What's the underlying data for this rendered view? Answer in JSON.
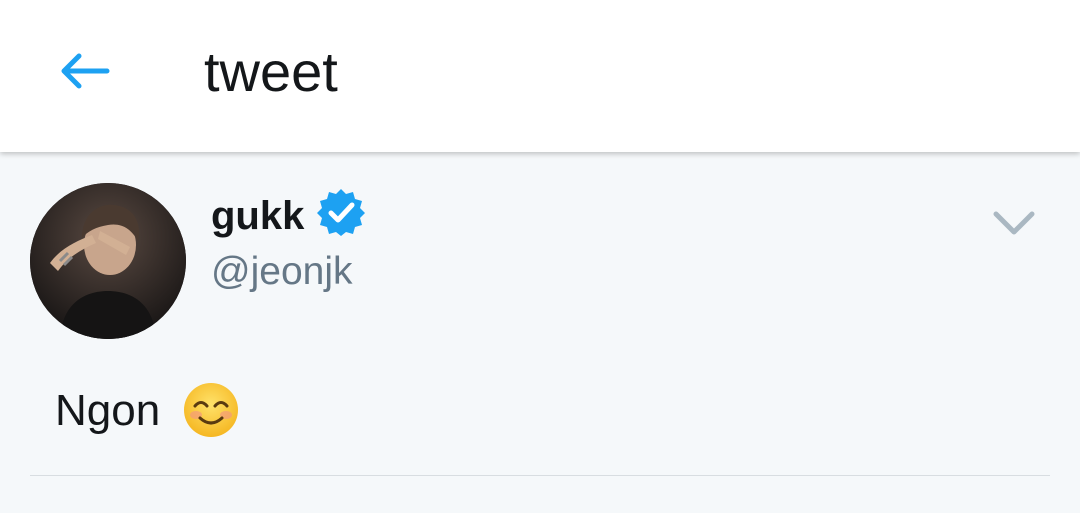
{
  "header": {
    "title": "tweet",
    "back_icon": "arrow-left-icon",
    "accent_color": "#1da1f2"
  },
  "tweet": {
    "display_name": "gukk",
    "verified": true,
    "verified_icon": "verified-badge-icon",
    "handle": "@jeonjk",
    "menu_icon": "chevron-down-icon",
    "text": "Ngon",
    "emoji": "smiling-face-with-smiling-eyes"
  }
}
